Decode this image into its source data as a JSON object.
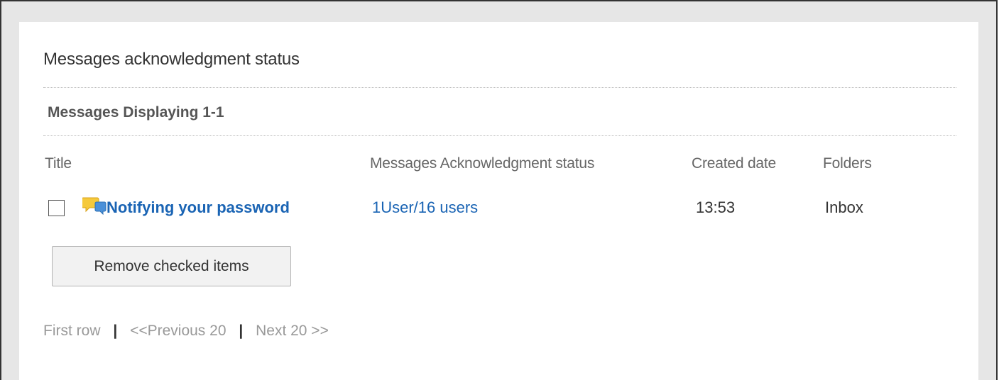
{
  "page": {
    "title": "Messages acknowledgment status"
  },
  "section": {
    "title": "Messages Displaying 1-1"
  },
  "table": {
    "columns": [
      "Title",
      "Messages Acknowledgment status",
      "Created date",
      "Folders"
    ],
    "rows": [
      {
        "checked": false,
        "icon": "message-bubble-icon",
        "title": "Notifying your password",
        "acknowledgment": "1User/16 users",
        "created": "13:53",
        "folder": "Inbox"
      }
    ]
  },
  "actions": {
    "remove_label": "Remove checked items"
  },
  "pager": {
    "first": "First row",
    "prev": "<<Previous 20",
    "next": "Next 20 >>",
    "separator": "|"
  },
  "colors": {
    "link": "#1a64b4",
    "disabled_text": "#999999",
    "frame_bg": "#e6e6e6",
    "icon_yellow": "#f5c93b",
    "icon_blue": "#4a90d9"
  }
}
